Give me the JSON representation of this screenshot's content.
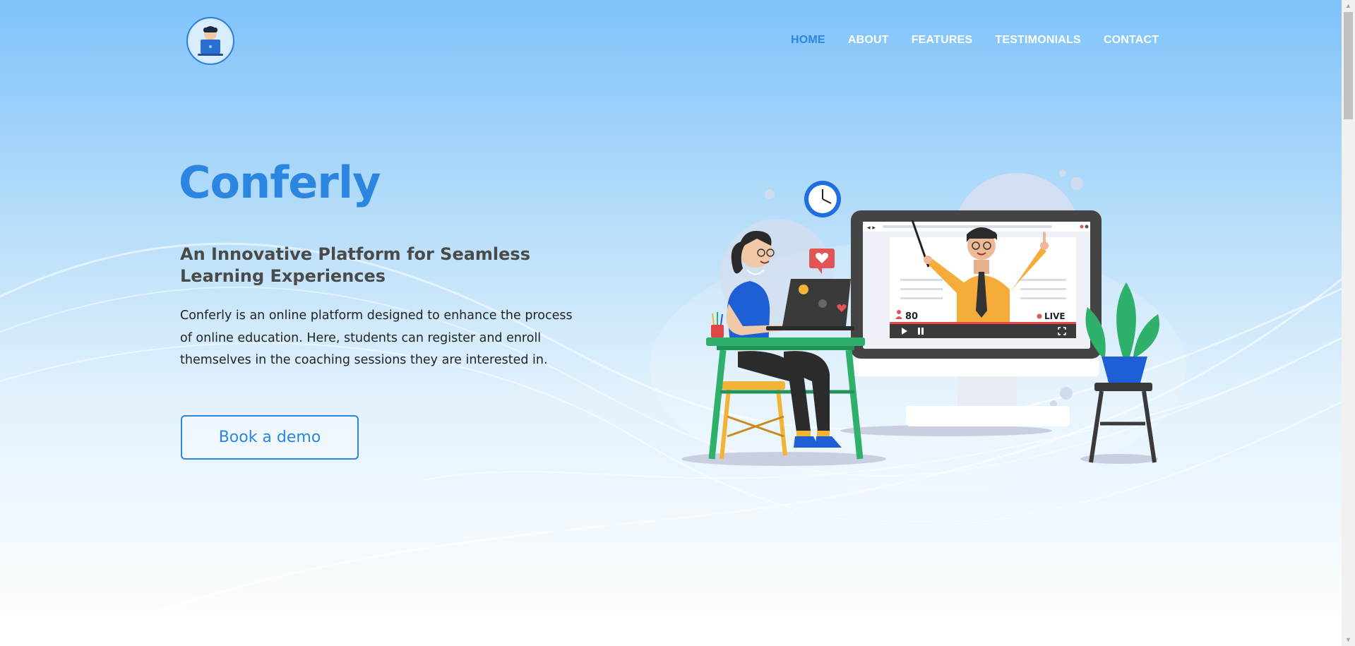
{
  "nav": {
    "items": [
      {
        "label": "HOME",
        "active": true
      },
      {
        "label": "ABOUT",
        "active": false
      },
      {
        "label": "FEATURES",
        "active": false
      },
      {
        "label": "TESTIMONIALS",
        "active": false
      },
      {
        "label": "CONTACT",
        "active": false
      }
    ]
  },
  "hero": {
    "title": "Conferly",
    "subtitle": "An Innovative Platform for Seamless Learning Experiences",
    "description": "Conferly is an online platform designed to enhance the process of online education. Here, students can register and enroll themselves in the coaching sessions they are interested in.",
    "cta_label": "Book a demo"
  },
  "illustration": {
    "viewer_count": "80",
    "live_label": "LIVE"
  },
  "colors": {
    "accent": "#2a86e0",
    "nav_text": "#ffffff",
    "subtitle": "#4a4a4a"
  },
  "icons": [
    "logo-avatar-icon",
    "clock-icon",
    "heart-bubble-icon",
    "play-icon",
    "pause-icon",
    "fullscreen-icon",
    "user-icon"
  ]
}
